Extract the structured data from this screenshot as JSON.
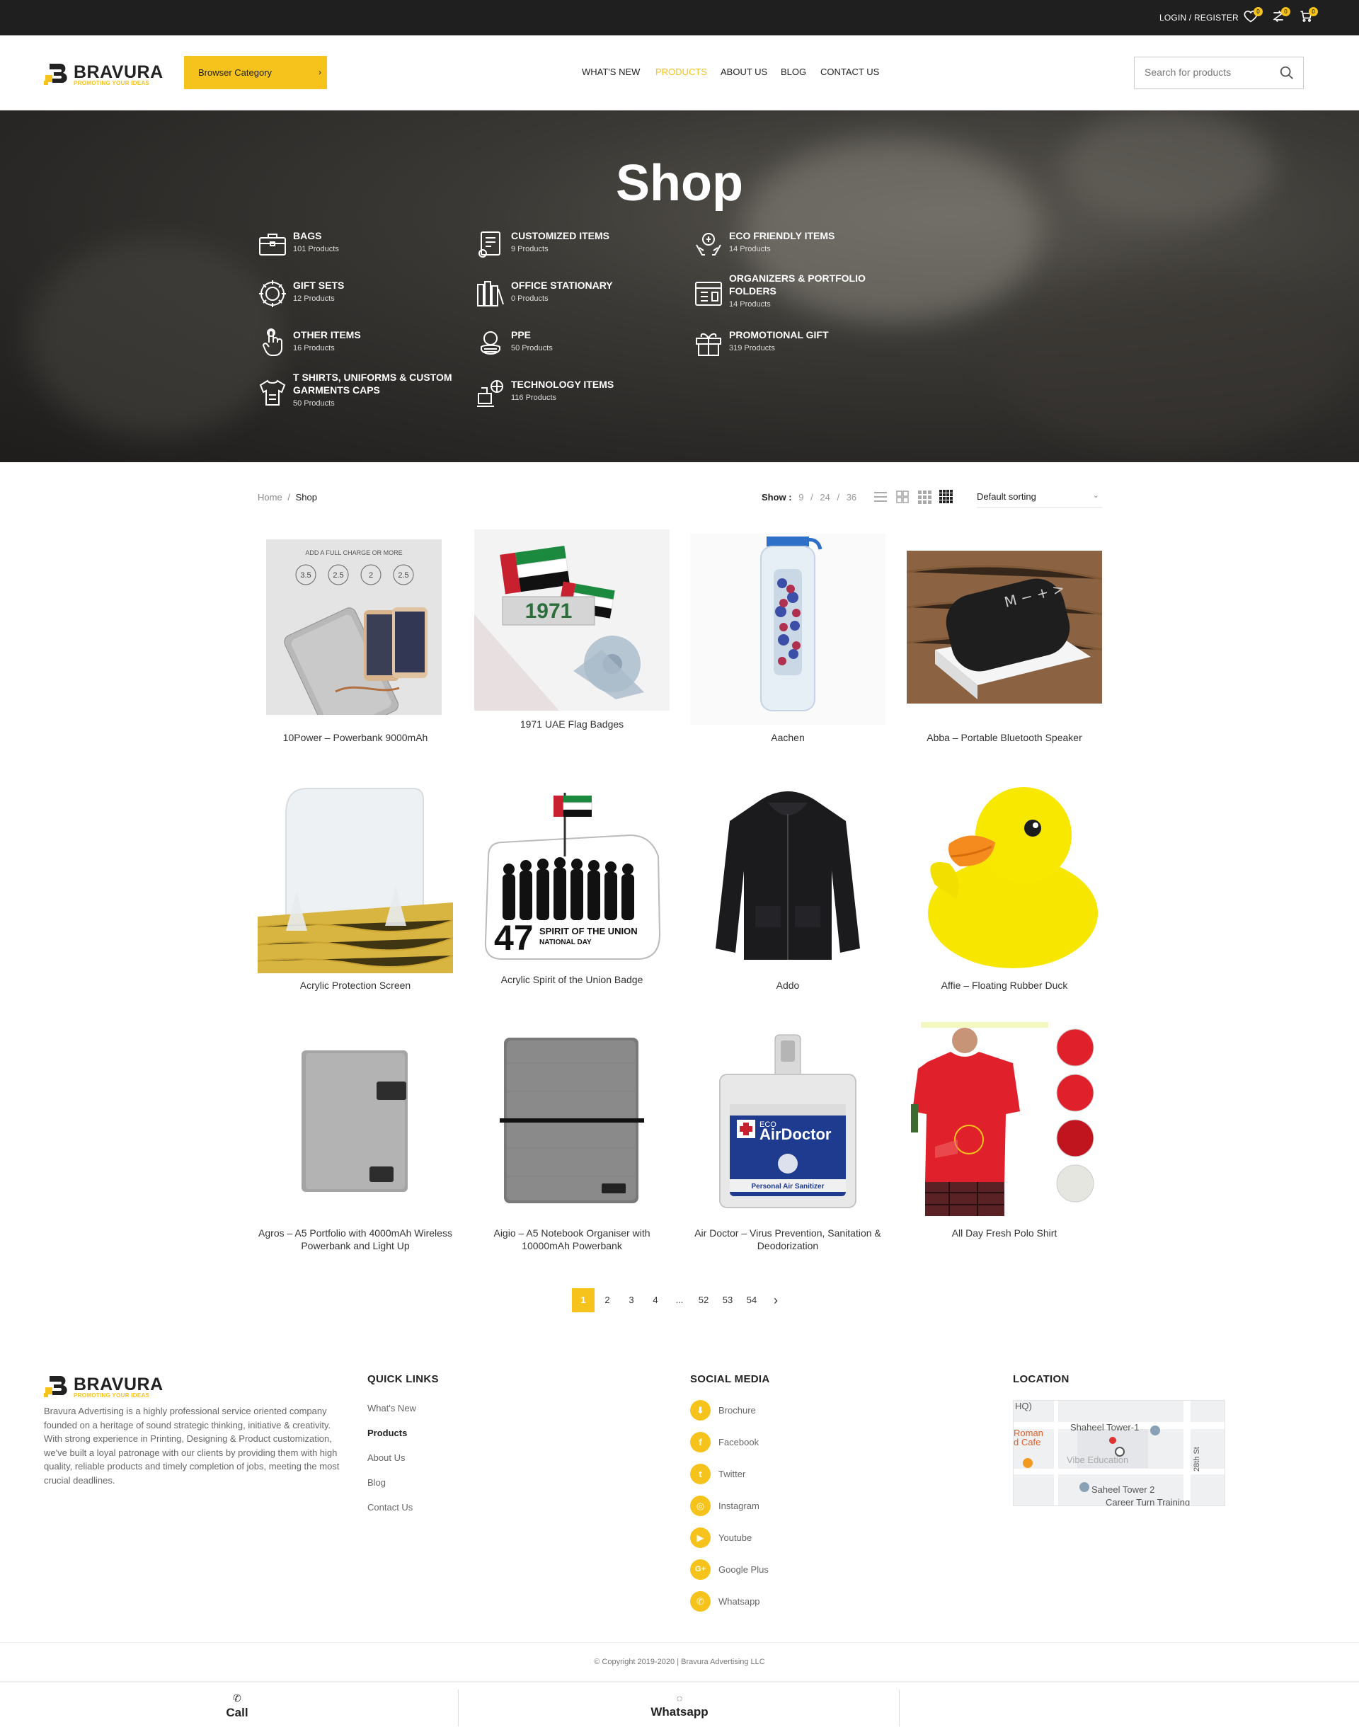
{
  "topbar": {
    "login": "LOGIN / REGISTER",
    "wishlist_count": "0",
    "compare_count": "0",
    "cart_count": "0"
  },
  "header": {
    "logo_name": "BRAVURA",
    "logo_tagline": "PROMOTING YOUR IDEAS",
    "browse_label": "Browser Category",
    "nav": [
      "WHAT'S NEW",
      "PRODUCTS",
      "ABOUT US",
      "BLOG",
      "CONTACT US"
    ],
    "search_placeholder": "Search for products"
  },
  "hero": {
    "title": "Shop",
    "categories": [
      {
        "name": "BAGS",
        "count": "101 Products",
        "icon": "briefcase-icon"
      },
      {
        "name": "CUSTOMIZED ITEMS",
        "count": "9 Products",
        "icon": "certificate-icon"
      },
      {
        "name": "ECO FRIENDLY ITEMS",
        "count": "14 Products",
        "icon": "eco-hands-icon"
      },
      {
        "name": "GIFT SETS",
        "count": "12 Products",
        "icon": "gear-badge-icon"
      },
      {
        "name": "OFFICE STATIONARY",
        "count": "0 Products",
        "icon": "binders-icon"
      },
      {
        "name": "ORGANIZERS & PORTFOLIO FOLDERS",
        "count": "14 Products",
        "icon": "organizer-icon"
      },
      {
        "name": "OTHER ITEMS",
        "count": "16 Products",
        "icon": "touch-hand-icon"
      },
      {
        "name": "PPE",
        "count": "50 Products",
        "icon": "mask-icon"
      },
      {
        "name": "PROMOTIONAL GIFT",
        "count": "319 Products",
        "icon": "gift-icon"
      },
      {
        "name": "T SHIRTS, UNIFORMS & CUSTOM GARMENTS CAPS",
        "count": "50 Products",
        "icon": "shirt-icon"
      },
      {
        "name": "TECHNOLOGY ITEMS",
        "count": "116 Products",
        "icon": "network-icon"
      }
    ]
  },
  "toolbar": {
    "breadcrumb_home": "Home",
    "breadcrumb_sep": "/",
    "breadcrumb_current": "Shop",
    "show_label": "Show :",
    "show_options": [
      "9",
      "24",
      "36"
    ],
    "sort_label": "Default sorting"
  },
  "products": [
    {
      "title": "10Power – Powerbank 9000mAh",
      "image": "powerbank"
    },
    {
      "title": "1971 UAE Flag Badges",
      "image": "flag-badges"
    },
    {
      "title": "Aachen",
      "image": "bottle"
    },
    {
      "title": "Abba – Portable Bluetooth Speaker",
      "image": "speaker"
    },
    {
      "title": "Acrylic Protection Screen",
      "image": "acrylic-screen"
    },
    {
      "title": "Acrylic Spirit of the Union Badge",
      "image": "union-badge"
    },
    {
      "title": "Addo",
      "image": "hoodie"
    },
    {
      "title": "Affie – Floating Rubber Duck",
      "image": "duck"
    },
    {
      "title": "Agros – A5 Portfolio with 4000mAh Wireless Powerbank and Light Up",
      "image": "portfolio"
    },
    {
      "title": "Aigio – A5 Notebook Organiser with 10000mAh Powerbank",
      "image": "notebook"
    },
    {
      "title": "Air Doctor – Virus Prevention, Sanitation & Deodorization",
      "image": "air-doctor"
    },
    {
      "title": "All Day Fresh Polo Shirt",
      "image": "polo"
    }
  ],
  "badge_text": {
    "union_number": "47",
    "union_line1": "SPIRIT OF THE UNION",
    "union_line2": "NATIONAL DAY",
    "airdoctor_eco": "ECO",
    "airdoctor_name": "AirDoctor",
    "airdoctor_sub": "Personal Air Sanitizer",
    "powerbank_caption": "ADD A FULL CHARGE OR MORE",
    "powerbank_charges": [
      "3.5",
      "2.5",
      "2",
      "2.5"
    ]
  },
  "pagination": {
    "pages": [
      "1",
      "2",
      "3",
      "4",
      "...",
      "52",
      "53",
      "54"
    ],
    "current": "1",
    "next": "›"
  },
  "footer": {
    "about": "Bravura Advertising is a highly professional service oriented company founded on a heritage of sound strategic thinking, initiative & creativity. With strong experience in Printing, Designing & Product customization, we've built a loyal patronage with our clients by providing them with high quality, reliable products and timely completion of jobs, meeting the most crucial deadlines.",
    "quick_links_title": "QUICK LINKS",
    "quick_links": [
      "What's New",
      "Products",
      "About Us",
      "Blog",
      "Contact Us"
    ],
    "social_title": "SOCIAL MEDIA",
    "social": [
      "Brochure",
      "Facebook",
      "Twitter",
      "Instagram",
      "Youtube",
      "Google Plus",
      "Whatsapp"
    ],
    "location_title": "LOCATION",
    "map_labels": [
      "HQ)",
      "Shaheel Tower-1",
      "Roman",
      "d Cafe",
      "Vibe Education",
      "Saheel Tower 2",
      "Career Turn Training",
      "28th St"
    ],
    "copyright": "© Copyright 2019-2020 | Bravura Advertising LLC"
  },
  "bottombar": {
    "call": "Call",
    "whatsapp": "Whatsapp"
  },
  "colors": {
    "accent": "#f6c31c",
    "dark": "#1f1f1f"
  }
}
